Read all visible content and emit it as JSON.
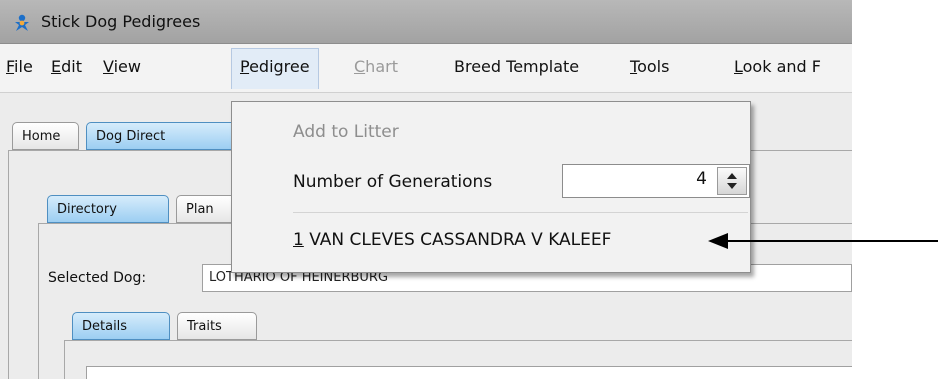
{
  "window": {
    "title": "Stick Dog Pedigrees",
    "icon": "dog-app-icon"
  },
  "menubar": [
    {
      "mnemonic": "F",
      "rest": "ile",
      "enabled": true
    },
    {
      "mnemonic": "E",
      "rest": "dit",
      "enabled": true
    },
    {
      "mnemonic": "V",
      "rest": "iew",
      "enabled": true
    },
    {
      "mnemonic": "P",
      "rest": "edigree",
      "enabled": true,
      "open": true
    },
    {
      "mnemonic": "C",
      "rest": "hart",
      "enabled": false
    },
    {
      "mnemonic": "",
      "rest": "Breed Template",
      "enabled": true
    },
    {
      "mnemonic": "T",
      "rest": "ools",
      "enabled": true
    },
    {
      "mnemonic": "L",
      "rest": "ook and F",
      "enabled": true
    }
  ],
  "main_tabs": {
    "home": "Home",
    "dog_directory": "Dog Direct"
  },
  "sub_tabs": {
    "directory": "Directory",
    "plan": "Plan"
  },
  "selected_dog": {
    "label": "Selected Dog:",
    "value": "LOTHARIO OF HEINERBURG"
  },
  "detail_tabs": {
    "details": "Details",
    "traits": "Traits"
  },
  "pedigree_menu": {
    "add_to_litter": "Add to Litter",
    "generations_label": "Number of Generations",
    "generations_value": "4",
    "recent_number": "1",
    "recent_name": " VAN CLEVES CASSANDRA V KALEEF"
  },
  "annotation": {
    "arrow": "pointer-arrow"
  },
  "colors": {
    "active_tab": "#9ccef2",
    "menu_open": "#e2ecf7",
    "icon_blue": "#1c6fc9"
  }
}
